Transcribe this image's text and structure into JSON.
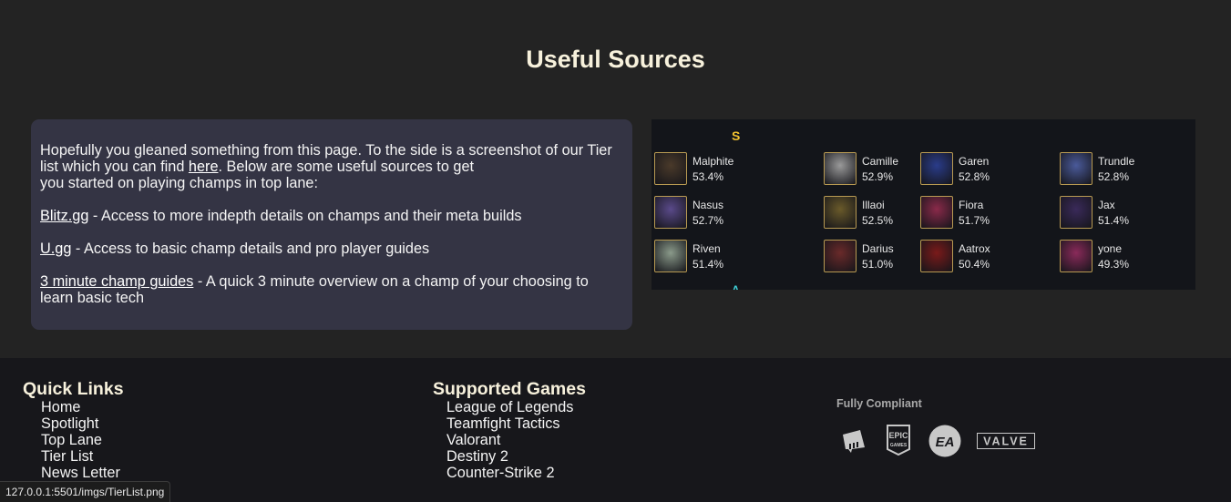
{
  "page": {
    "title": "Useful Sources"
  },
  "intro": {
    "text_before_link": "Hopefully you gleaned something from this page. To the side is a screenshot of our Tier list which you can find ",
    "link_label": "here",
    "text_after_link_line1": ". Below are some useful sources to get",
    "text_after_link_line2": "you started on playing champs in top lane:"
  },
  "sources": [
    {
      "link": "Blitz.gg",
      "description": " - Access to more indepth details on champs and their meta builds"
    },
    {
      "link": "U.gg",
      "description": " - Access to basic champ details and pro player guides"
    },
    {
      "link": "3 minute champ guides",
      "description": " - A quick 3 minute overview on a champ of your choosing to learn basic tech"
    }
  ],
  "tier_list_image": {
    "tier": "S",
    "next_tier": "A",
    "champions": [
      {
        "name": "Malphite",
        "win_rate": "53.4%",
        "color": "#4a3a2a"
      },
      {
        "name": "Camille",
        "win_rate": "52.9%",
        "color": "#9a9a9a"
      },
      {
        "name": "Garen",
        "win_rate": "52.8%",
        "color": "#2a3c8a"
      },
      {
        "name": "Trundle",
        "win_rate": "52.8%",
        "color": "#4a5a9a"
      },
      {
        "name": "Nasus",
        "win_rate": "52.7%",
        "color": "#5a4a8a"
      },
      {
        "name": "Illaoi",
        "win_rate": "52.5%",
        "color": "#6a5a2a"
      },
      {
        "name": "Fiora",
        "win_rate": "51.7%",
        "color": "#8a2a4a"
      },
      {
        "name": "Jax",
        "win_rate": "51.4%",
        "color": "#3a2a5a"
      },
      {
        "name": "Riven",
        "win_rate": "51.4%",
        "color": "#8a9a8a"
      },
      {
        "name": "Darius",
        "win_rate": "51.0%",
        "color": "#6a2a2a"
      },
      {
        "name": "Aatrox",
        "win_rate": "50.4%",
        "color": "#7a1a1a"
      },
      {
        "name": "yone",
        "win_rate": "49.3%",
        "color": "#8a2a5a"
      }
    ]
  },
  "footer": {
    "quick_links": {
      "heading": "Quick Links",
      "items": [
        "Home",
        "Spotlight",
        "Top Lane",
        "Tier List",
        "News Letter"
      ]
    },
    "supported_games": {
      "heading": "Supported Games",
      "items": [
        "League of Legends",
        "Teamfight Tactics",
        "Valorant",
        "Destiny 2",
        "Counter-Strike 2"
      ]
    },
    "compliance": {
      "label": "Fully Compliant",
      "logos": [
        "riot-games-logo",
        "epic-games-logo",
        "ea-logo",
        "valve-logo"
      ],
      "epic_top": "EPIC",
      "epic_bottom": "GAMES",
      "ea_text": "EA",
      "valve_text": "VALVE"
    }
  },
  "status_bar": {
    "url": "127.0.0.1:5501/imgs/TierList.png"
  }
}
